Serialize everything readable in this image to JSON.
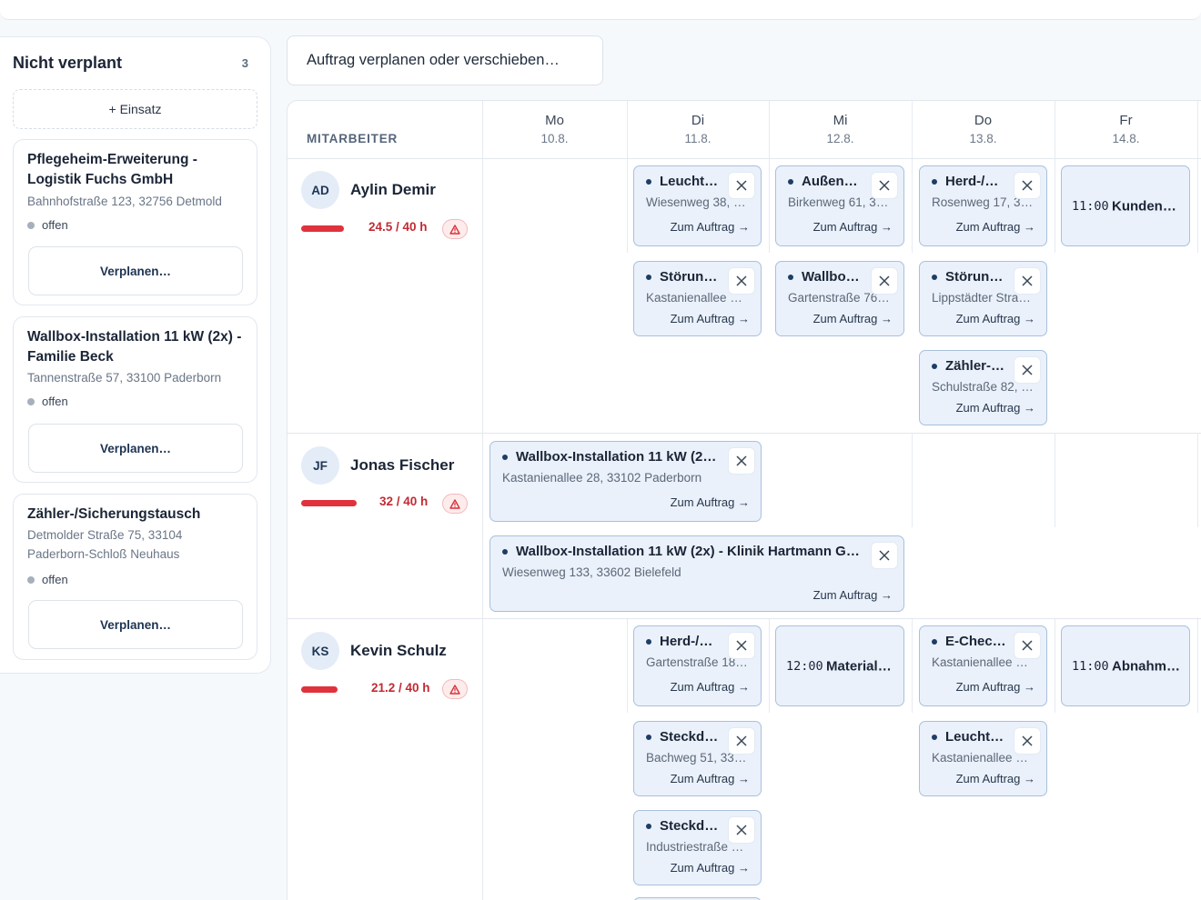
{
  "sidebar": {
    "title": "Nicht verplant",
    "count": "3",
    "add_label": "+ Einsatz",
    "cards": [
      {
        "title": "Pflegeheim-Erweiterung - Logistik Fuchs GmbH",
        "address": "Bahnhofstraße 123, 32756 Detmold",
        "status": "offen",
        "button": "Verplanen…"
      },
      {
        "title": "Wallbox-Installation 11 kW (2x) - Familie Beck",
        "address": "Tannenstraße 57, 33100 Paderborn",
        "status": "offen",
        "button": "Verplanen…"
      },
      {
        "title": "Zähler-/Sicherungstausch",
        "address": "Detmolder Straße 75, 33104 Paderborn-Schloß Neuhaus",
        "status": "offen",
        "button": "Verplanen…"
      }
    ]
  },
  "search": {
    "label": "Auftrag verplanen oder verschieben…"
  },
  "grid": {
    "employee_header": "MITARBEITER",
    "days": [
      {
        "day": "Mo",
        "date": "10.8."
      },
      {
        "day": "Di",
        "date": "11.8."
      },
      {
        "day": "Mi",
        "date": "12.8."
      },
      {
        "day": "Do",
        "date": "13.8."
      },
      {
        "day": "Fr",
        "date": "14.8."
      }
    ],
    "link_label": "Zum Auftrag →",
    "employees": [
      {
        "initials": "AD",
        "name": "Aylin Demir",
        "hours": "24.5 / 40 h",
        "load": 0.6125
      },
      {
        "initials": "JF",
        "name": "Jonas Fischer",
        "hours": "32 / 40 h",
        "load": 0.8
      },
      {
        "initials": "KS",
        "name": "Kevin Schulz",
        "hours": "21.2 / 40 h",
        "load": 0.53
      }
    ],
    "jobs": {
      "ad_di_1": {
        "title": "Leucht…",
        "address": "Wiesenweg 38, 3…"
      },
      "ad_mi_1": {
        "title": "Außen…",
        "address": "Birkenweg 61, 33…"
      },
      "ad_do_1": {
        "title": "Herd-/…",
        "address": "Rosenweg 17, 331…"
      },
      "ad_fr_1": {
        "time": "11:00",
        "title": "Kundeng…"
      },
      "ad_di_2": {
        "title": "Störun…",
        "address": "Kastanienallee 6…"
      },
      "ad_mi_2": {
        "title": "Wallbo…",
        "address": "Gartenstraße 76, …"
      },
      "ad_do_2": {
        "title": "Störun…",
        "address": "Lippstädter Straß…"
      },
      "ad_do_3": {
        "title": "Zähler-…",
        "address": "Schulstraße 82, 3…"
      },
      "jf_1": {
        "title": "Wallbox-Installation 11 kW (2…",
        "address": "Kastanienallee 28, 33102 Paderborn"
      },
      "jf_2": {
        "title": "Wallbox-Installation 11 kW (2x) - Klinik Hartmann G…",
        "address": "Wiesenweg 133, 33602 Bielefeld"
      },
      "ks_di_1": {
        "title": "Herd-/…",
        "address": "Gartenstraße 18, …"
      },
      "ks_mi_1": {
        "time": "12:00",
        "title": "Materialp…"
      },
      "ks_do_1": {
        "title": "E-Chec…",
        "address": "Kastanienallee 2…"
      },
      "ks_fr_1": {
        "time": "11:00",
        "title": "Abnahme…"
      },
      "ks_di_2": {
        "title": "Steckd…",
        "address": "Bachweg 51, 336…"
      },
      "ks_do_2": {
        "title": "Leucht…",
        "address": "Kastanienallee 6…"
      },
      "ks_di_3": {
        "title": "Steckd…",
        "address": "Industriestraße 4…"
      }
    }
  },
  "colors": {
    "accent": "#1f3d63",
    "overload": "#e0323c",
    "card_bg": "#eaf1fb",
    "card_border": "#a9c0dc"
  }
}
